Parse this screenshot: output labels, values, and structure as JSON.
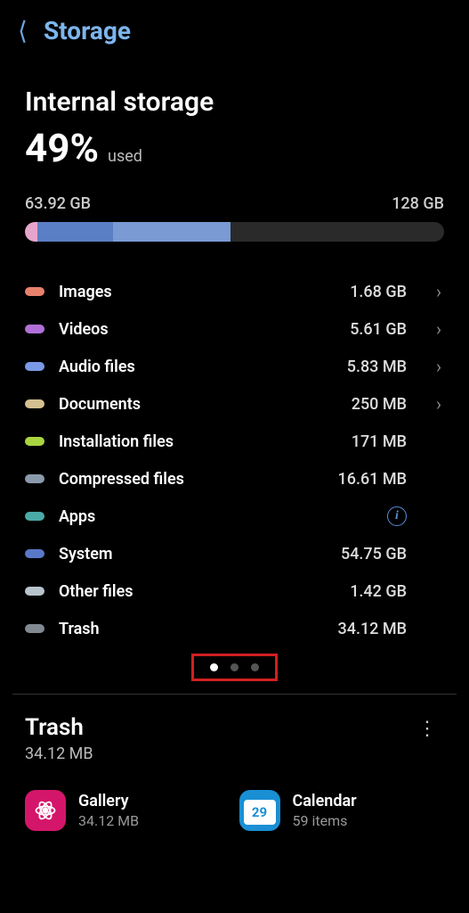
{
  "header": {
    "title": "Storage"
  },
  "main": {
    "title": "Internal storage",
    "percent": "49%",
    "used_label": "used",
    "used_capacity": "63.92 GB",
    "total_capacity": "128 GB"
  },
  "bar_segments": [
    {
      "color": "#e8a5cc",
      "width": "3%"
    },
    {
      "color": "#5a7fc4",
      "width": "18%"
    },
    {
      "color": "#7a9ad4",
      "width": "28%"
    }
  ],
  "categories": [
    {
      "label": "Images",
      "size": "1.68 GB",
      "color": "#e8816b",
      "chevron": true
    },
    {
      "label": "Videos",
      "size": "5.61 GB",
      "color": "#b070d8",
      "chevron": true
    },
    {
      "label": "Audio files",
      "size": "5.83 MB",
      "color": "#7a9ae8",
      "chevron": true
    },
    {
      "label": "Documents",
      "size": "250 MB",
      "color": "#d4c090",
      "chevron": true
    },
    {
      "label": "Installation files",
      "size": "171 MB",
      "color": "#a8d440",
      "chevron": false
    },
    {
      "label": "Compressed files",
      "size": "16.61 MB",
      "color": "#8a9aaa",
      "chevron": false
    },
    {
      "label": "Apps",
      "size": "",
      "color": "#4aaaa8",
      "info": true
    },
    {
      "label": "System",
      "size": "54.75 GB",
      "color": "#5a78c8",
      "chevron": false
    },
    {
      "label": "Other files",
      "size": "1.42 GB",
      "color": "#b8c4cc",
      "chevron": false
    },
    {
      "label": "Trash",
      "size": "34.12 MB",
      "color": "#808890",
      "chevron": false
    }
  ],
  "trash_section": {
    "title": "Trash",
    "size": "34.12 MB"
  },
  "trash_apps": [
    {
      "name": "Gallery",
      "sub": "34.12 MB",
      "icon": "gallery"
    },
    {
      "name": "Calendar",
      "sub": "59 items",
      "icon": "calendar",
      "day": "29"
    }
  ]
}
